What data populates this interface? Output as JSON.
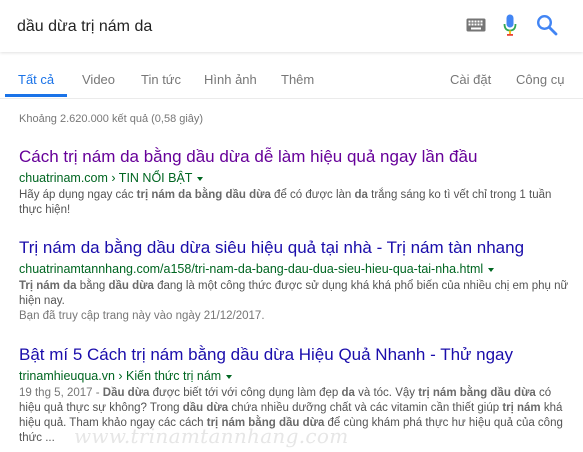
{
  "search": {
    "query": "dầu dừa trị nám da",
    "keyboard_icon": "keyboard-icon",
    "mic_icon": "microphone-icon",
    "search_icon": "search-icon"
  },
  "tabs": {
    "all": "Tất cả",
    "video": "Video",
    "news": "Tin tức",
    "images": "Hình ảnh",
    "more": "Thêm",
    "settings": "Cài đặt",
    "tools": "Công cụ",
    "active_color": "#1a73e8"
  },
  "result_stats": "Khoảng 2.620.000 kết quả (0,58 giây)",
  "results": [
    {
      "title": "Cách trị nám da bằng dầu dừa dễ làm hiệu quả ngay lần đầu",
      "url": "chuatrinam.com › TIN NỔI BẬT",
      "snippet": [
        {
          "t": "Hãy áp dụng ngay các ",
          "b": false
        },
        {
          "t": "trị nám da bằng dầu dừa",
          "b": true
        },
        {
          "t": " để có được làn ",
          "b": false
        },
        {
          "t": "da",
          "b": true
        },
        {
          "t": " trắng sáng ko tì vết chỉ trong 1 tuần thực hiện!",
          "b": false
        }
      ]
    },
    {
      "title": "Trị nám da bằng dầu dừa siêu hiệu quả tại nhà - Trị nám tàn nhang",
      "url": "chuatrinamtannhang.com/a158/tri-nam-da-bang-dau-dua-sieu-hieu-qua-tai-nha.html",
      "snippet": [
        {
          "t": "Trị nám da",
          "b": true
        },
        {
          "t": " bằng ",
          "b": false
        },
        {
          "t": "dầu dừa",
          "b": true
        },
        {
          "t": " đang là một công thức được sử dụng khá khá phổ biến của nhiều chị em phụ nữ hiện nay.",
          "b": false
        }
      ],
      "visited": "Bạn đã truy cập trang này vào ngày 21/12/2017."
    },
    {
      "title": "Bật mí 5 Cách trị nám bằng dầu dừa Hiệu Quả Nhanh - Thử ngay",
      "url": "trinamhieuqua.vn › Kiến thức trị nám",
      "date": "19 thg 5, 2017 - ",
      "snippet": [
        {
          "t": "Dầu dừa",
          "b": true
        },
        {
          "t": " được biết tới với công dụng làm đẹp ",
          "b": false
        },
        {
          "t": "da",
          "b": true
        },
        {
          "t": " và tóc. Vậy ",
          "b": false
        },
        {
          "t": "trị nám bằng dầu dừa",
          "b": true
        },
        {
          "t": " có hiệu quả thực sự không? Trong ",
          "b": false
        },
        {
          "t": "dầu dừa",
          "b": true
        },
        {
          "t": " chứa nhiều dưỡng chất và các vitamin cần thiết giúp ",
          "b": false
        },
        {
          "t": "trị nám",
          "b": true
        },
        {
          "t": " khá hiệu quả. Tham khảo ngay các cách ",
          "b": false
        },
        {
          "t": "trị nám bằng dầu dừa",
          "b": true
        },
        {
          "t": " để cùng khám phá thực hư hiệu quả của công thức ...",
          "b": false
        }
      ]
    }
  ],
  "watermark": "www.trinamtannhang.com"
}
